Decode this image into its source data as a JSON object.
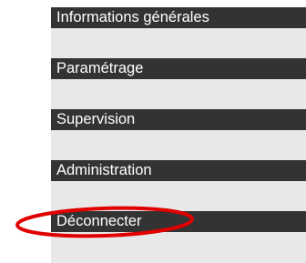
{
  "menu": {
    "items": [
      {
        "label": "Informations générales"
      },
      {
        "label": "Paramétrage"
      },
      {
        "label": "Supervision"
      },
      {
        "label": "Administration"
      },
      {
        "label": "Déconnecter"
      }
    ]
  },
  "colors": {
    "header_bg": "#333333",
    "sub_bg": "#e8e8e8",
    "highlight": "#e00000"
  }
}
